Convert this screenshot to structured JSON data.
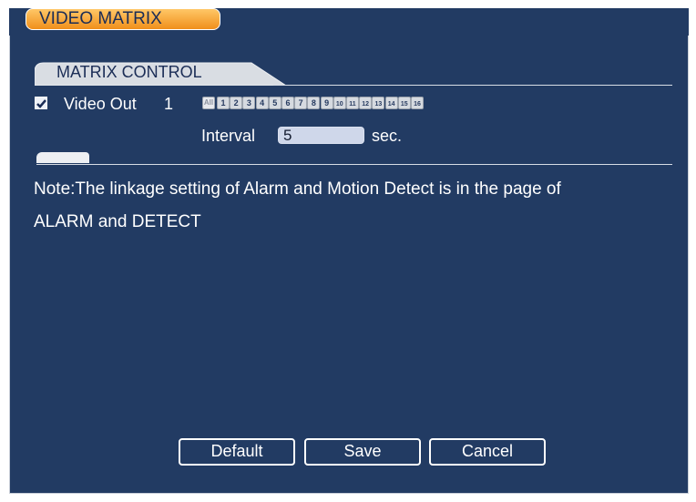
{
  "window": {
    "title": "VIDEO MATRIX"
  },
  "section": {
    "title": "MATRIX CONTROL"
  },
  "video_out": {
    "checked": true,
    "label": "Video Out",
    "number": "1",
    "channels": {
      "all_label": "All",
      "items": [
        "1",
        "2",
        "3",
        "4",
        "5",
        "6",
        "7",
        "8",
        "9",
        "10",
        "11",
        "12",
        "13",
        "14",
        "15",
        "16"
      ]
    },
    "interval_label": "Interval",
    "interval_value": "5",
    "interval_unit": "sec."
  },
  "note": {
    "line1": "Note:The linkage setting of Alarm and Motion Detect is in the page of",
    "line2": "ALARM and DETECT"
  },
  "buttons": {
    "default": "Default",
    "save": "Save",
    "cancel": "Cancel"
  },
  "colors": {
    "panel_bg": "#223b63",
    "title_tab": "#f39a2a",
    "text": "#ffffff"
  }
}
